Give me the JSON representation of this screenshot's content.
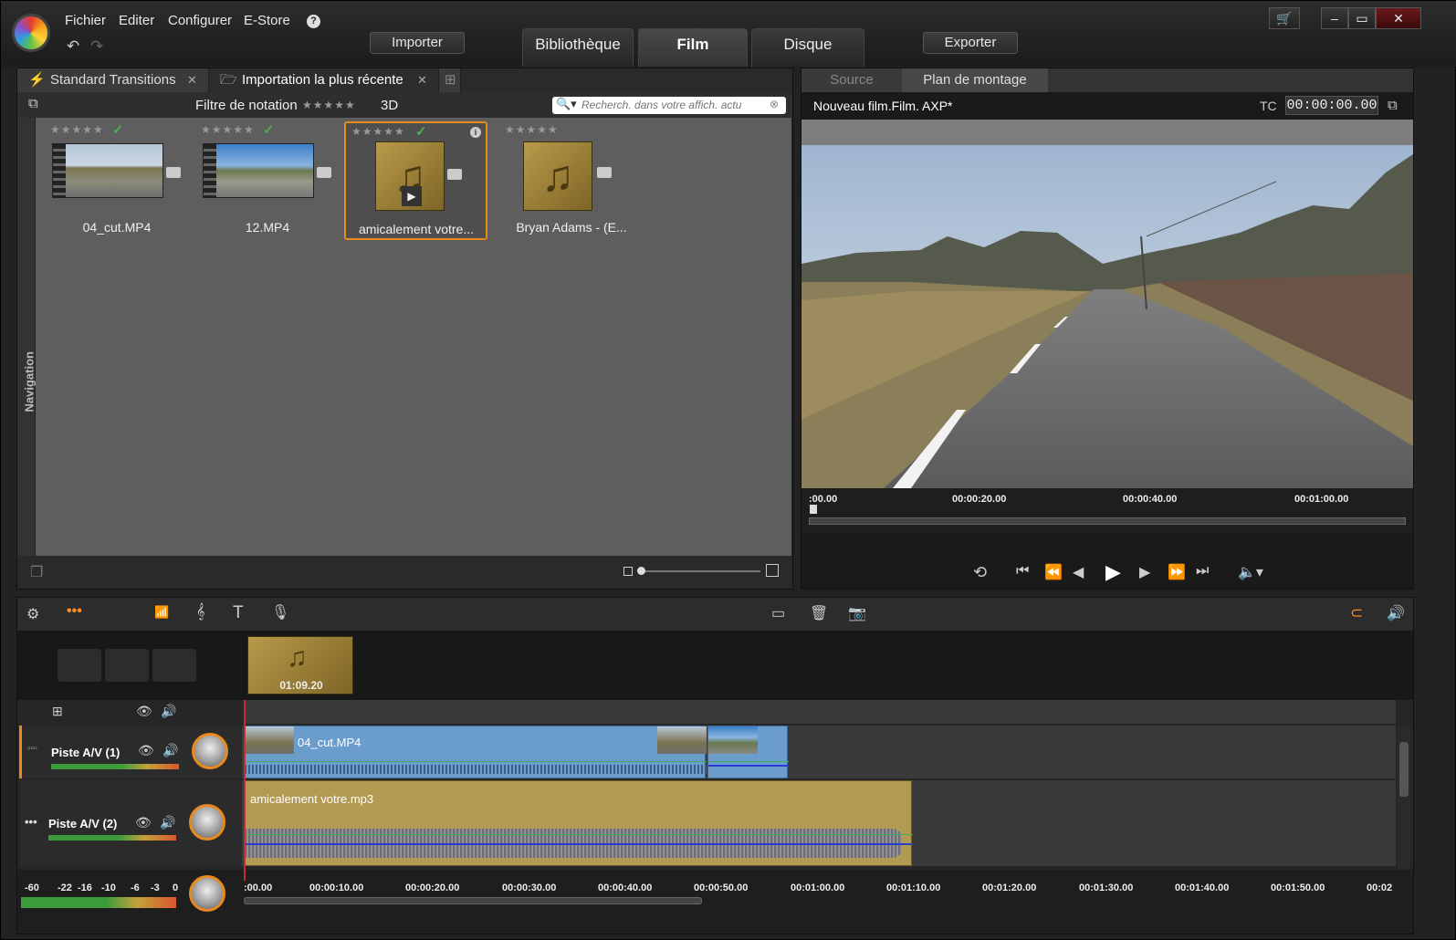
{
  "menu": {
    "items": [
      "Fichier",
      "Editer",
      "Configurer",
      "E-Store"
    ]
  },
  "toolbar": {
    "import": "Importer",
    "export": "Exporter"
  },
  "tabs": [
    {
      "label": "Bibliothèque"
    },
    {
      "label": "Film"
    },
    {
      "label": "Disque"
    }
  ],
  "library": {
    "tabs": [
      {
        "label": "Standard Transitions"
      },
      {
        "label": "Importation la plus récente"
      }
    ],
    "filter_label": "Filtre de notation",
    "threed": "3D",
    "search_placeholder": "Recherch. dans votre affich. actu",
    "nav_label": "Navigation",
    "items": [
      {
        "name": "04_cut.MP4",
        "type": "video",
        "checked": true
      },
      {
        "name": "12.MP4",
        "type": "video",
        "checked": true
      },
      {
        "name": "amicalement votre...",
        "type": "audio",
        "checked": true,
        "selected": true
      },
      {
        "name": "Bryan Adams - (E...",
        "type": "audio",
        "checked": false
      }
    ]
  },
  "preview": {
    "tabs": [
      {
        "label": "Source"
      },
      {
        "label": "Plan de montage"
      }
    ],
    "title": "Nouveau film.Film. AXP*",
    "tc_label": "TC",
    "timecode": "00:00:00.00",
    "ruler": [
      ":00.00",
      "00:00:20.00",
      "00:00:40.00",
      "00:01:00.00"
    ]
  },
  "timeline": {
    "storyboard_clip_duration": "01:09.20",
    "tracks": [
      {
        "name": "Piste A/V (1)",
        "clip": "04_cut.MP4"
      },
      {
        "name": "Piste A/V (2)",
        "clip": "amicalement votre.mp3"
      }
    ],
    "meter_scale": [
      "-60",
      "-22",
      "-16",
      "-10",
      "-6",
      "-3",
      "0"
    ],
    "ruler": [
      ":00.00",
      "00:00:10.00",
      "00:00:20.00",
      "00:00:30.00",
      "00:00:40.00",
      "00:00:50.00",
      "00:01:00.00",
      "00:01:10.00",
      "00:01:20.00",
      "00:01:30.00",
      "00:01:40.00",
      "00:01:50.00",
      "00:02"
    ]
  },
  "colors": {
    "accent": "#e88a1d",
    "video_clip": "#6a9ccc",
    "audio_clip": "#b39a52"
  }
}
